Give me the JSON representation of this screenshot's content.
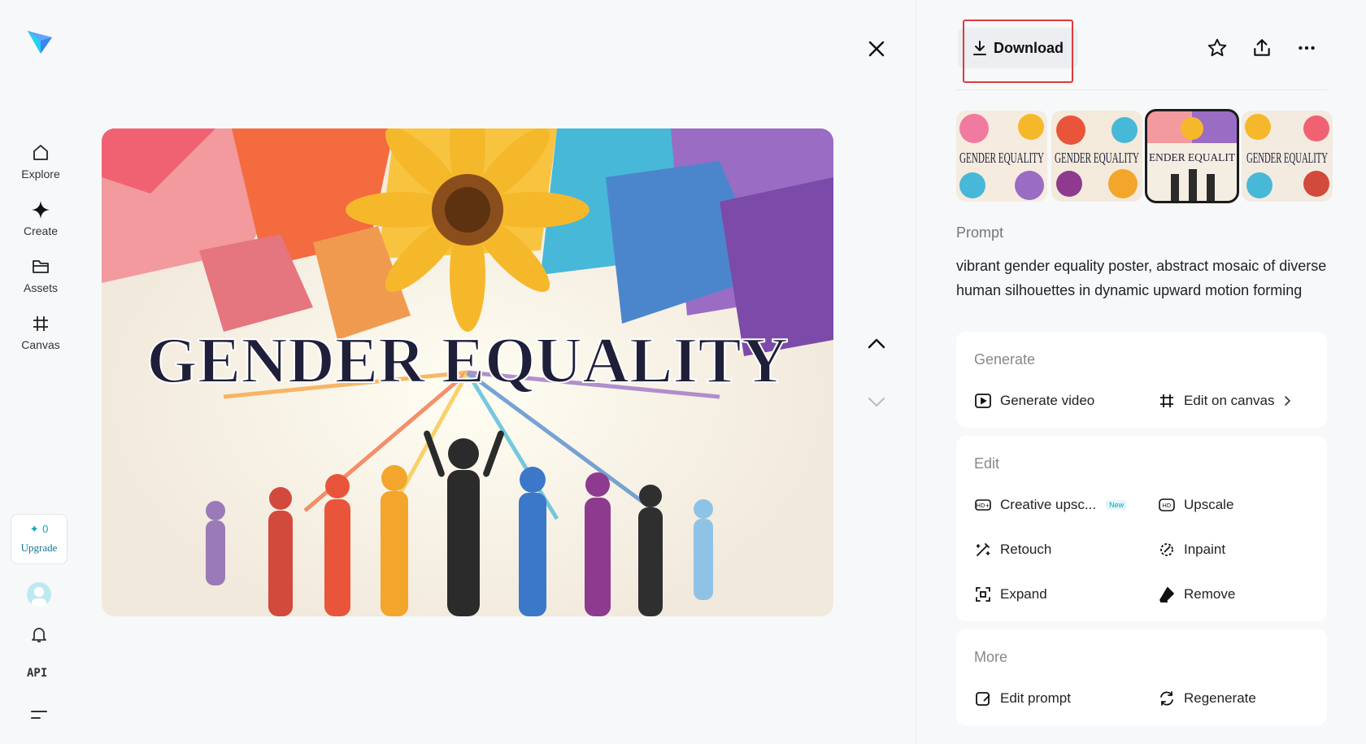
{
  "sidebar": {
    "nav": [
      {
        "label": "Explore",
        "icon": "home-icon"
      },
      {
        "label": "Create",
        "icon": "sparkle-icon"
      },
      {
        "label": "Assets",
        "icon": "folder-icon"
      },
      {
        "label": "Canvas",
        "icon": "canvas-icon"
      }
    ],
    "credits": "0",
    "upgrade_label": "Upgrade",
    "api_label": "API"
  },
  "viewer": {
    "image_text": "GENDER EQUALITY"
  },
  "panel": {
    "download_label": "Download",
    "thumbnails": [
      {
        "text": "GENDER EQUALITY",
        "selected": false
      },
      {
        "text": "GENDER EQUALITY",
        "selected": false
      },
      {
        "text": "ENDER EQUALIT",
        "selected": true
      },
      {
        "text": "GENDER EQUALITY",
        "selected": false
      }
    ],
    "prompt_label": "Prompt",
    "prompt_text": "vibrant gender equality poster, abstract mosaic of diverse human silhouettes in dynamic upward motion forming",
    "generate": {
      "title": "Generate",
      "actions": [
        "Generate video",
        "Edit on canvas"
      ]
    },
    "edit": {
      "title": "Edit",
      "actions": [
        "Creative upsc...",
        "Upscale",
        "Retouch",
        "Inpaint",
        "Expand",
        "Remove"
      ],
      "new_badge": "New"
    },
    "more": {
      "title": "More",
      "actions": [
        "Edit prompt",
        "Regenerate"
      ]
    }
  },
  "colors": {
    "accent": "#0ea5b7",
    "highlight": "#e0393e",
    "background": "#f7f8fa"
  }
}
